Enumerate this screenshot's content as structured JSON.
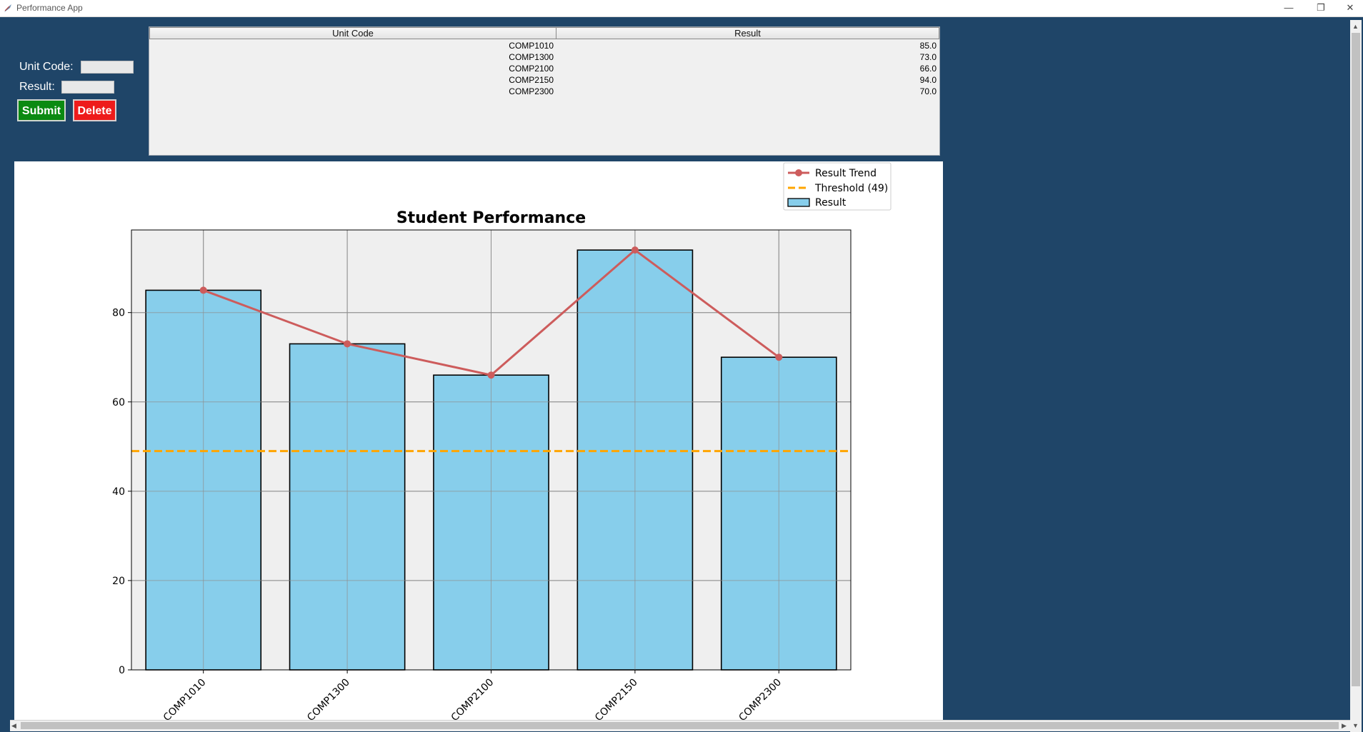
{
  "window": {
    "title": "Performance App",
    "icon": "feather-icon",
    "controls": [
      "minimize-icon",
      "restore-icon",
      "close-icon"
    ]
  },
  "form": {
    "unit_code_label": "Unit Code:",
    "unit_code_value": "",
    "result_label": "Result:",
    "result_value": "",
    "submit_label": "Submit",
    "delete_label": "Delete"
  },
  "table": {
    "columns": [
      "Unit Code",
      "Result"
    ],
    "rows": [
      [
        "COMP1010",
        "85.0"
      ],
      [
        "COMP1300",
        "73.0"
      ],
      [
        "COMP2100",
        "66.0"
      ],
      [
        "COMP2150",
        "94.0"
      ],
      [
        "COMP2300",
        "70.0"
      ]
    ]
  },
  "chart_data": {
    "type": "bar",
    "title": "Student Performance",
    "categories": [
      "COMP1010",
      "COMP1300",
      "COMP2100",
      "COMP2150",
      "COMP2300"
    ],
    "series": [
      {
        "name": "Result",
        "kind": "bar",
        "values": [
          85,
          73,
          66,
          94,
          70
        ],
        "color": "#87ceeb"
      },
      {
        "name": "Result Trend",
        "kind": "line",
        "values": [
          85,
          73,
          66,
          94,
          70
        ],
        "color": "#cd5c5c"
      }
    ],
    "threshold": {
      "name": "Threshold (49)",
      "value": 49,
      "color": "#ffa500"
    },
    "ylim": [
      0,
      98.5
    ],
    "yticks": [
      0,
      20,
      40,
      60,
      80
    ],
    "xlabel": "",
    "ylabel": "",
    "grid": true,
    "legend_position": "top-right",
    "legend": [
      "Result Trend",
      "Threshold (49)",
      "Result"
    ]
  },
  "colors": {
    "background": "#1f4568",
    "submit": "#0b8a12",
    "delete": "#ee1b1b",
    "plot_background": "#efefef"
  }
}
